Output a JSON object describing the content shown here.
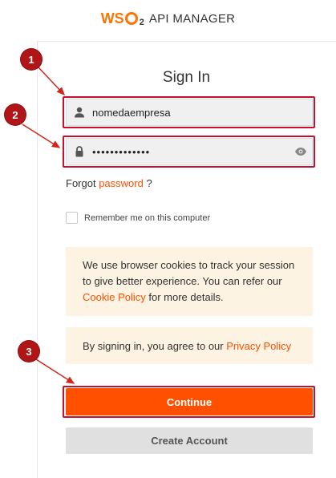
{
  "header": {
    "logo_text_a": "WS",
    "logo_text_b": "2",
    "product": "API MANAGER",
    "brand_color": "#ff7300"
  },
  "title": "Sign In",
  "username": {
    "value": "nomedaempresa",
    "icon": "user-icon"
  },
  "password": {
    "value": "•••••••••••••",
    "icon": "lock-icon",
    "toggle_icon": "eye-icon"
  },
  "forgot": {
    "prefix": "Forgot",
    "link": "password",
    "suffix": "?"
  },
  "remember": {
    "label": "Remember me on this computer",
    "checked": false
  },
  "cookie_notice": {
    "text_before": "We use browser cookies to track your session to give better experience. You can refer our",
    "link": "Cookie Policy",
    "text_after": "for more details."
  },
  "privacy_notice": {
    "text_before": "By signing in, you agree to our",
    "link": "Privacy Policy"
  },
  "buttons": {
    "continue": "Continue",
    "create_account": "Create Account"
  },
  "annotations": [
    "1",
    "2",
    "3"
  ],
  "colors": {
    "accent": "#ff5000",
    "notice_bg": "#fdf3e3",
    "annotation_red": "#c8102e",
    "secondary_button": "#e0e0e0"
  }
}
